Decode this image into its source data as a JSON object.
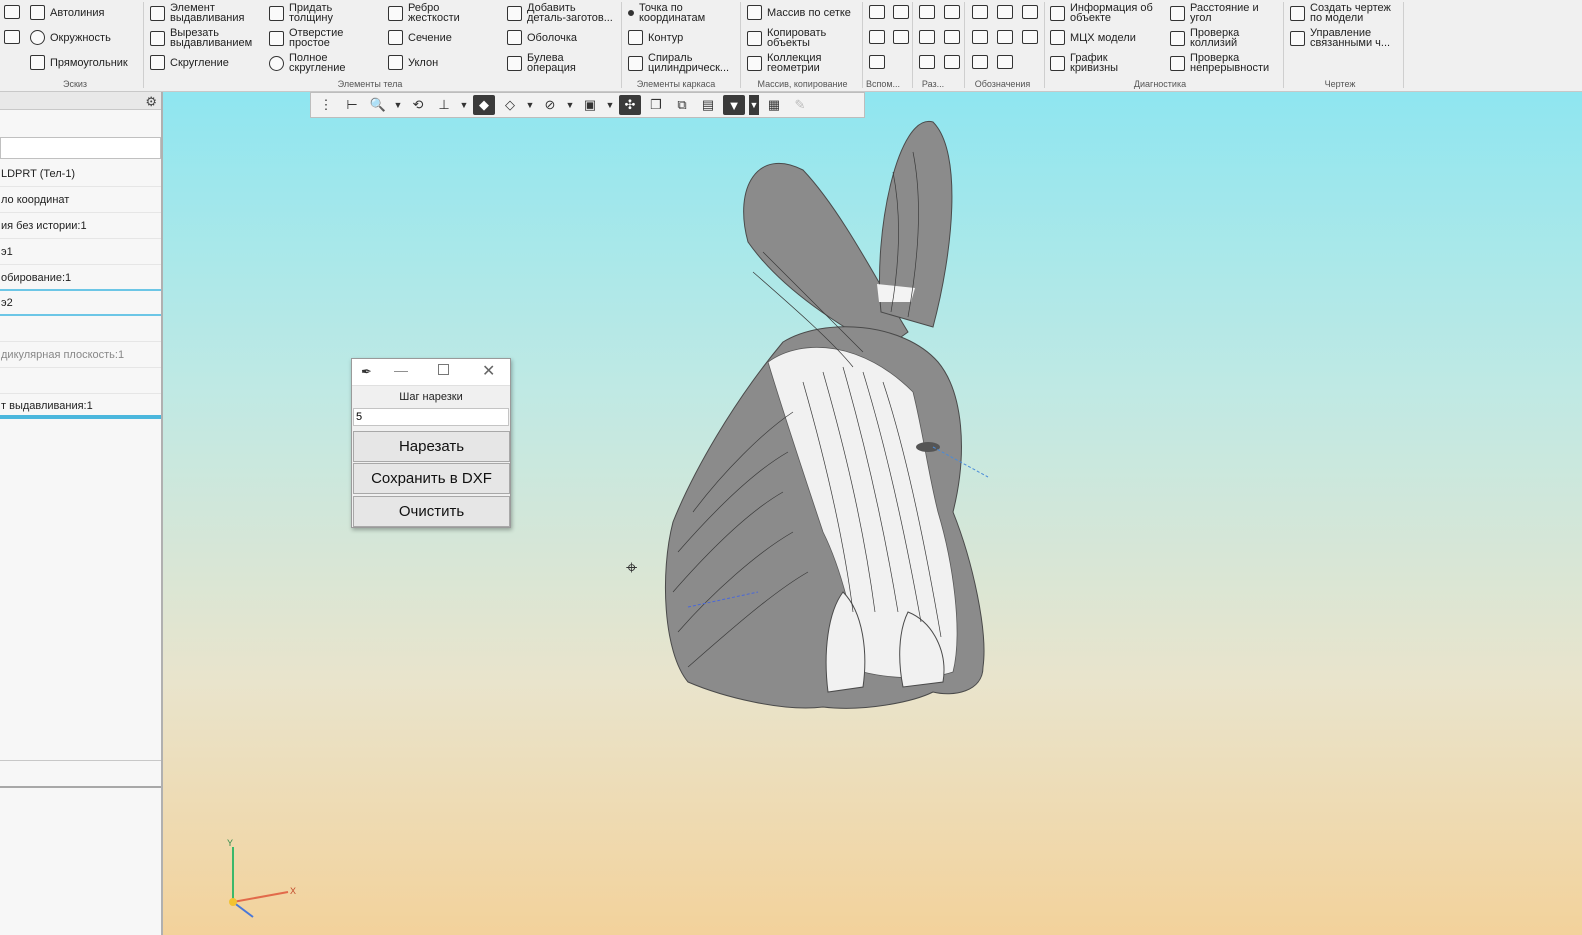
{
  "ribbon": {
    "groups": [
      {
        "label": "Эскиз",
        "items": [
          "Автолиния",
          "Окружность",
          "Прямоугольник"
        ]
      },
      {
        "label": "Элементы тела",
        "items": [
          "Элемент\nвыдавливания",
          "Вырезать\nвыдавливанием",
          "Скругление",
          "Придать\nтолщину",
          "Отверстие\nпростое",
          "Полное\nскругление",
          "Ребро\nжесткости",
          "Сечение",
          "Уклон",
          "Добавить\nдеталь-заготов...",
          "Оболочка",
          "Булева\nоперация"
        ]
      },
      {
        "label": "Элементы каркаса",
        "items": [
          "Точка по\nкоординатам",
          "Контур",
          "Спираль\nцилиндрическ..."
        ]
      },
      {
        "label": "Массив, копирование",
        "items": [
          "Массив по сетке",
          "Копировать\nобъекты",
          "Коллекция\nгеометрии"
        ]
      },
      {
        "label": "Вспом...",
        "items": []
      },
      {
        "label": "Раз...",
        "items": []
      },
      {
        "label": "Обозначения",
        "items": []
      },
      {
        "label": "Диагностика",
        "items": [
          "Информация об\nобъекте",
          "МЦХ модели",
          "График\nкривизны",
          "Расстояние и\nугол",
          "Проверка\nколлизий",
          "Проверка\nнепрерывности"
        ]
      },
      {
        "label": "Чертеж",
        "items": [
          "Создать чертеж\nпо модели",
          "Управление\nсвязанными ч..."
        ]
      }
    ]
  },
  "tree": {
    "rows": [
      "LDPRT (Тел-1)",
      "ло координат",
      "ия без истории:1",
      "э1",
      "обирование:1",
      "э2",
      "",
      "дикулярная плоскость:1",
      "",
      "т выдавливания:1"
    ]
  },
  "dialog": {
    "label": "Шаг нарезки",
    "value": "5",
    "buttons": [
      "Нарезать",
      "Сохранить в DXF",
      "Очистить"
    ]
  },
  "triad": {
    "x": "X",
    "y": "Y"
  },
  "colors": {
    "model_gray": "#8a8a8a",
    "model_white": "#f2f2f2"
  }
}
